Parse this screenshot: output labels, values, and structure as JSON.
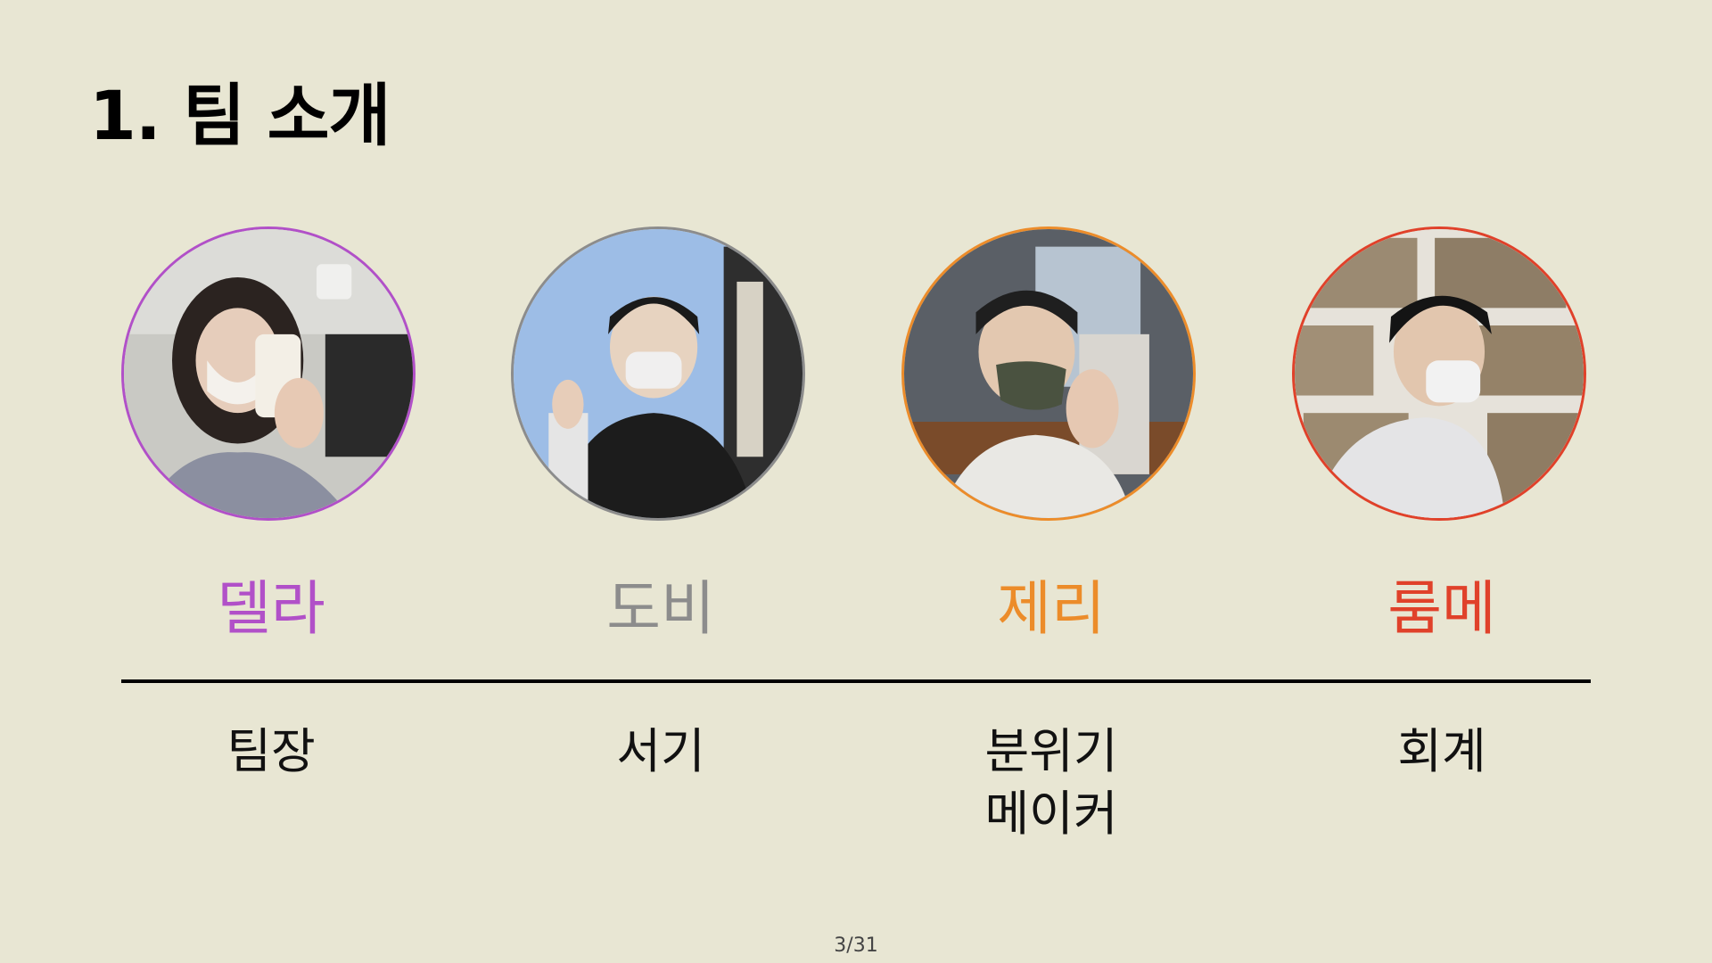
{
  "slide": {
    "title": "1. 팀 소개",
    "page": "3/31"
  },
  "members": [
    {
      "name": "델라",
      "role_lines": [
        "팀장"
      ],
      "color": "#b150c8",
      "photo_icon": "person-photo"
    },
    {
      "name": "도비",
      "role_lines": [
        "서기"
      ],
      "color": "#8c8c8c",
      "photo_icon": "person-photo"
    },
    {
      "name": "제리",
      "role_lines": [
        "분위기",
        "메이커"
      ],
      "color": "#ec8c2a",
      "photo_icon": "person-photo"
    },
    {
      "name": "룸메",
      "role_lines": [
        "회계"
      ],
      "color": "#e0412a",
      "photo_icon": "person-photo"
    }
  ],
  "colors": {
    "background": "#e8e6d3",
    "text": "#000000"
  }
}
